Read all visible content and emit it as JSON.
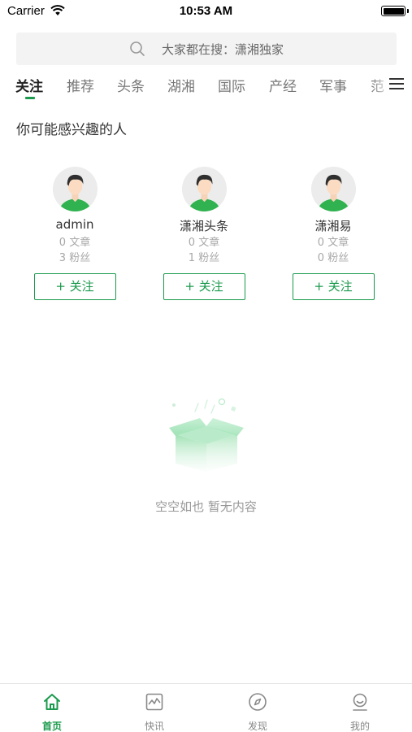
{
  "status_bar": {
    "carrier": "Carrier",
    "time": "10:53 AM"
  },
  "search": {
    "placeholder": "大家都在搜：潇湘独家"
  },
  "tabs": [
    {
      "label": "关注"
    },
    {
      "label": "推荐"
    },
    {
      "label": "头条"
    },
    {
      "label": "湖湘"
    },
    {
      "label": "国际"
    },
    {
      "label": "产经"
    },
    {
      "label": "军事"
    },
    {
      "label": "范"
    }
  ],
  "section_title": "你可能感兴趣的人",
  "users": [
    {
      "name": "admin",
      "articles": "0 文章",
      "fans": "3 粉丝",
      "follow": "+ 关注"
    },
    {
      "name": "潇湘头条",
      "articles": "0 文章",
      "fans": "1 粉丝",
      "follow": "+ 关注"
    },
    {
      "name": "潇湘易",
      "articles": "0 文章",
      "fans": "0 粉丝",
      "follow": "+ 关注"
    }
  ],
  "empty_text": "空空如也 暂无内容",
  "tabbar": [
    {
      "label": "首页",
      "icon": "home-icon"
    },
    {
      "label": "快讯",
      "icon": "chart-icon"
    },
    {
      "label": "发现",
      "icon": "compass-icon"
    },
    {
      "label": "我的",
      "icon": "profile-icon"
    }
  ],
  "colors": {
    "accent": "#1a9a4c",
    "muted": "#a8a8a8",
    "search_bg": "#f3f3f3"
  }
}
